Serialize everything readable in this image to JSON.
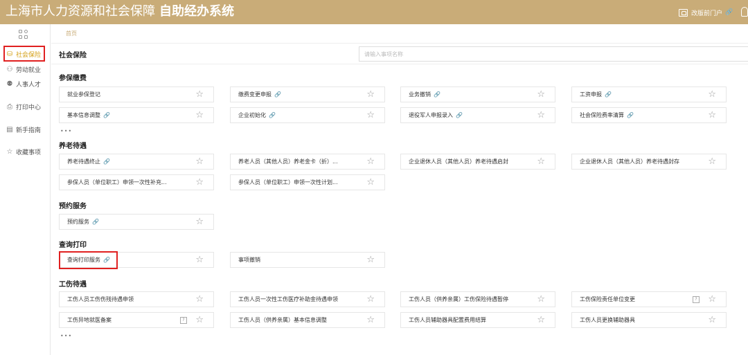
{
  "header": {
    "title": "上海市人力资源和社会保障",
    "subtitle": "自助经办系统",
    "portal_label": "改版前门户"
  },
  "sidebar": {
    "items": [
      {
        "label": "社会保险",
        "icon": "coins-icon"
      },
      {
        "label": "劳动就业",
        "icon": "person-icon"
      },
      {
        "label": "人事人才",
        "icon": "people-icon"
      },
      {
        "label": "打印中心",
        "icon": "printer-icon"
      },
      {
        "label": "新手指南",
        "icon": "guide-icon"
      },
      {
        "label": "收藏事项",
        "icon": "star-icon"
      }
    ]
  },
  "breadcrumb": "首页",
  "section": {
    "title": "社会保险",
    "search_placeholder": "请输入事项名称"
  },
  "categories": [
    {
      "title": "参保缴费"
    },
    {
      "title": "养老待遇"
    },
    {
      "title": "预约服务"
    },
    {
      "title": "查询打印"
    },
    {
      "title": "工伤待遇"
    }
  ],
  "more_label": "•••",
  "items": {
    "c0r0": [
      {
        "label": "就业参保登记"
      },
      {
        "label": "缴费变更申报",
        "link": "🔗"
      },
      {
        "label": "业务撤销",
        "link": "🔗"
      },
      {
        "label": "工资申报",
        "link": "🔗"
      }
    ],
    "c0r1": [
      {
        "label": "基本信息调整",
        "link": "🔗"
      },
      {
        "label": "企业初始化",
        "link": "🔗"
      },
      {
        "label": "退役军人申报录入",
        "link": "🔗"
      },
      {
        "label": "社会保险费率清算",
        "link": "🔗"
      }
    ],
    "c1r0": [
      {
        "label": "养老待遇终止",
        "link": "🔗"
      },
      {
        "label": "养老人员（其他人员）养老金卡（折）..."
      },
      {
        "label": "企业退休人员（其他人员）养老待遇启封"
      },
      {
        "label": "企业退休人员（其他人员）养老待遇封存"
      }
    ],
    "c1r1": [
      {
        "label": "参保人员（单位职工）申领一次性补充..."
      },
      {
        "label": "参保人员（单位职工）申领一次性计划..."
      }
    ],
    "c2r0": [
      {
        "label": "预约服务",
        "link": "🔗"
      }
    ],
    "c3r0": [
      {
        "label": "查询打印服务",
        "link": "🔗"
      },
      {
        "label": "事项撤销"
      }
    ],
    "c4r0": [
      {
        "label": "工伤人员工伤伤残待遇申领"
      },
      {
        "label": "工伤人员一次性工伤医疗补助金待遇申领"
      },
      {
        "label": "工伤人员（供养亲属）工伤保险待遇暂停"
      },
      {
        "label": "工伤保险责任单位变更",
        "help": "?"
      }
    ],
    "c4r1": [
      {
        "label": "工伤异地就医备案",
        "help": "?"
      },
      {
        "label": "工伤人员（供养亲属）基本信息调整"
      },
      {
        "label": "工伤人员辅助器具配置费用结算"
      },
      {
        "label": "工伤人员更换辅助器具"
      }
    ]
  },
  "star_glyph": "☆",
  "colors": {
    "header_bg": "#c9ac78",
    "active": "#d4a017",
    "highlight": "#e02020"
  }
}
